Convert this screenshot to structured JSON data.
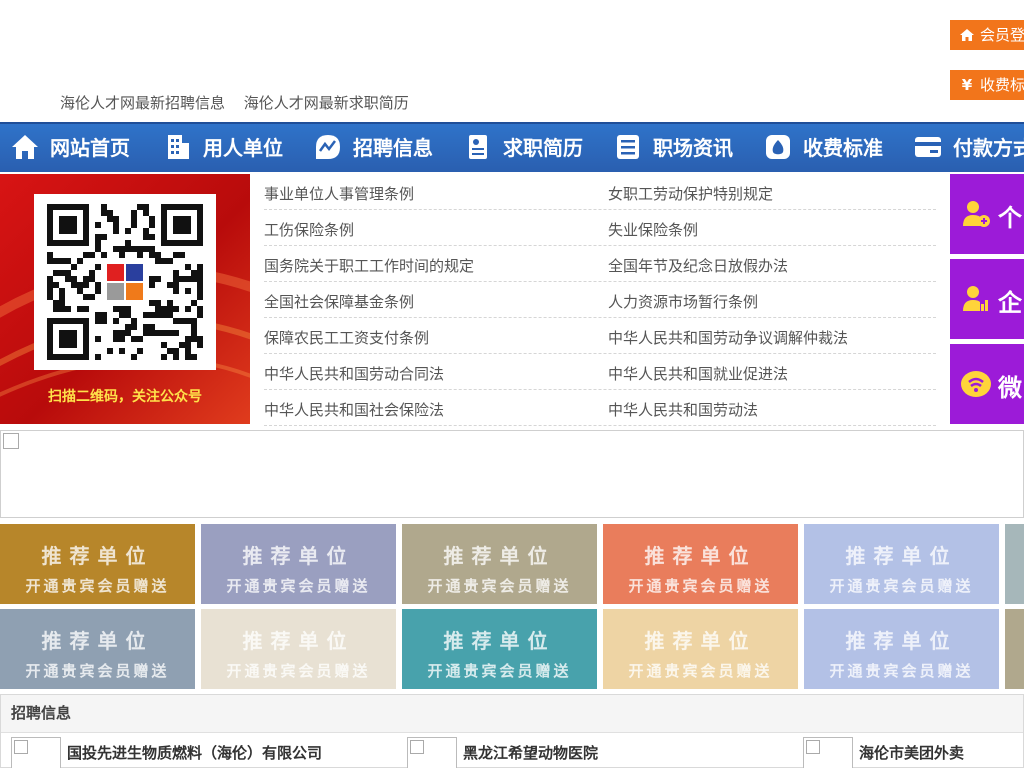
{
  "header": {
    "links": [
      "海伦人才网最新招聘信息",
      "海伦人才网最新求职简历"
    ],
    "login_label": "会员登",
    "fees_label": "收费标"
  },
  "nav": {
    "items": [
      {
        "label": "网站首页",
        "icon": "home-icon"
      },
      {
        "label": "用人单位",
        "icon": "building-icon"
      },
      {
        "label": "招聘信息",
        "icon": "chart-icon"
      },
      {
        "label": "求职简历",
        "icon": "resume-icon"
      },
      {
        "label": "职场资讯",
        "icon": "news-icon"
      },
      {
        "label": "收费标准",
        "icon": "moneybag-icon"
      },
      {
        "label": "付款方式",
        "icon": "card-icon"
      }
    ]
  },
  "qr": {
    "caption": "扫描二维码，关注公众号"
  },
  "laws": {
    "rows": [
      [
        "事业单位人事管理条例",
        "女职工劳动保护特别规定"
      ],
      [
        "工伤保险条例",
        "失业保险条例"
      ],
      [
        "国务院关于职工工作时间的规定",
        "全国年节及纪念日放假办法"
      ],
      [
        "全国社会保障基金条例",
        "人力资源市场暂行条例"
      ],
      [
        "保障农民工工资支付条例",
        "中华人民共和国劳动争议调解仲裁法"
      ],
      [
        "中华人民共和国劳动合同法",
        "中华人民共和国就业促进法"
      ],
      [
        "中华人民共和国社会保险法",
        "中华人民共和国劳动法"
      ]
    ]
  },
  "side": {
    "items": [
      {
        "label": "个",
        "icon": "person-add-icon"
      },
      {
        "label": "企",
        "icon": "person-chart-icon"
      },
      {
        "label": "微",
        "icon": "wechat-icon"
      }
    ]
  },
  "tiles": {
    "line1": "推荐单位",
    "line2": "开通贵宾会员赠送",
    "colors": [
      "#b7862a",
      "#9a9fc0",
      "#b0a88d",
      "#e97d5c",
      "#b3c1e6",
      "#a6b7ba",
      "#8fa0b2",
      "#e8e1d3",
      "#48a2ac",
      "#eed4a4",
      "#b3c1e6",
      "#b0a88d"
    ]
  },
  "recruit": {
    "title": "招聘信息",
    "companies": [
      "国投先进生物质燃料（海伦）有限公司",
      "黑龙江希望动物医院",
      "海伦市美团外卖"
    ]
  }
}
